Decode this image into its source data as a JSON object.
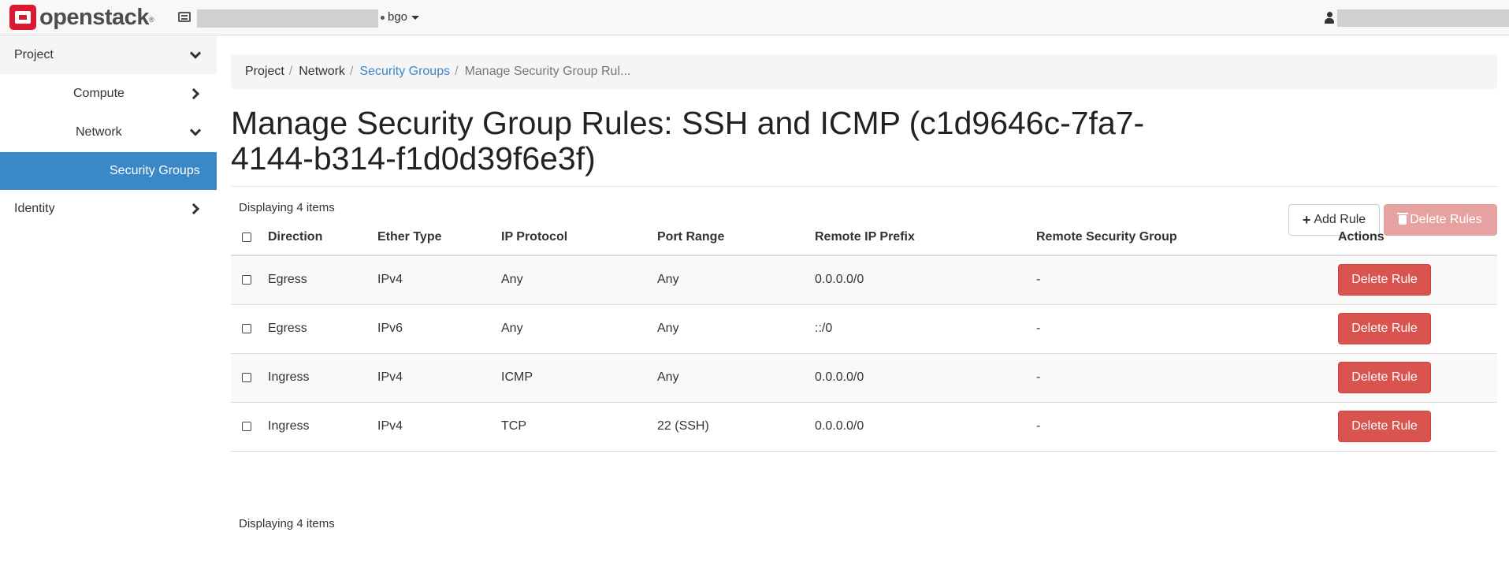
{
  "navbar": {
    "brand": "openstack",
    "brand_mark": "®",
    "region": "bgo",
    "context_icon": "context-list-icon",
    "user_icon": "user-icon"
  },
  "sidebar": {
    "items": [
      {
        "label": "Project"
      },
      {
        "label": "Compute"
      },
      {
        "label": "Network"
      },
      {
        "label": "Security Groups"
      },
      {
        "label": "Identity"
      }
    ]
  },
  "breadcrumb": [
    "Project",
    "Network",
    "Security Groups",
    "Manage Security Group Rul..."
  ],
  "title": {
    "line1": "Manage Security Group Rules: SSH and ICMP (c1d9646c-7fa7-",
    "line2": "4144-b314-f1d0d39f6e3f)"
  },
  "actions": {
    "add_rule": "Add Rule",
    "delete_rules": "Delete Rules"
  },
  "table": {
    "count_label": "Displaying 4 items",
    "columns": [
      "Direction",
      "Ether Type",
      "IP Protocol",
      "Port Range",
      "Remote IP Prefix",
      "Remote Security Group",
      "Actions"
    ],
    "rows": [
      {
        "direction": "Egress",
        "ether": "IPv4",
        "protocol": "Any",
        "port": "Any",
        "prefix": "0.0.0.0/0",
        "group": "-",
        "action": "Delete Rule"
      },
      {
        "direction": "Egress",
        "ether": "IPv6",
        "protocol": "Any",
        "port": "Any",
        "prefix": "::/0",
        "group": "-",
        "action": "Delete Rule"
      },
      {
        "direction": "Ingress",
        "ether": "IPv4",
        "protocol": "ICMP",
        "port": "Any",
        "prefix": "0.0.0.0/0",
        "group": "-",
        "action": "Delete Rule"
      },
      {
        "direction": "Ingress",
        "ether": "IPv4",
        "protocol": "TCP",
        "port": "22 (SSH)",
        "prefix": "0.0.0.0/0",
        "group": "-",
        "action": "Delete Rule"
      }
    ]
  },
  "colors": {
    "accent": "#3b88c9",
    "danger": "#d9534f",
    "danger_disabled": "#e6a2a1",
    "brand": "#da1a32"
  }
}
